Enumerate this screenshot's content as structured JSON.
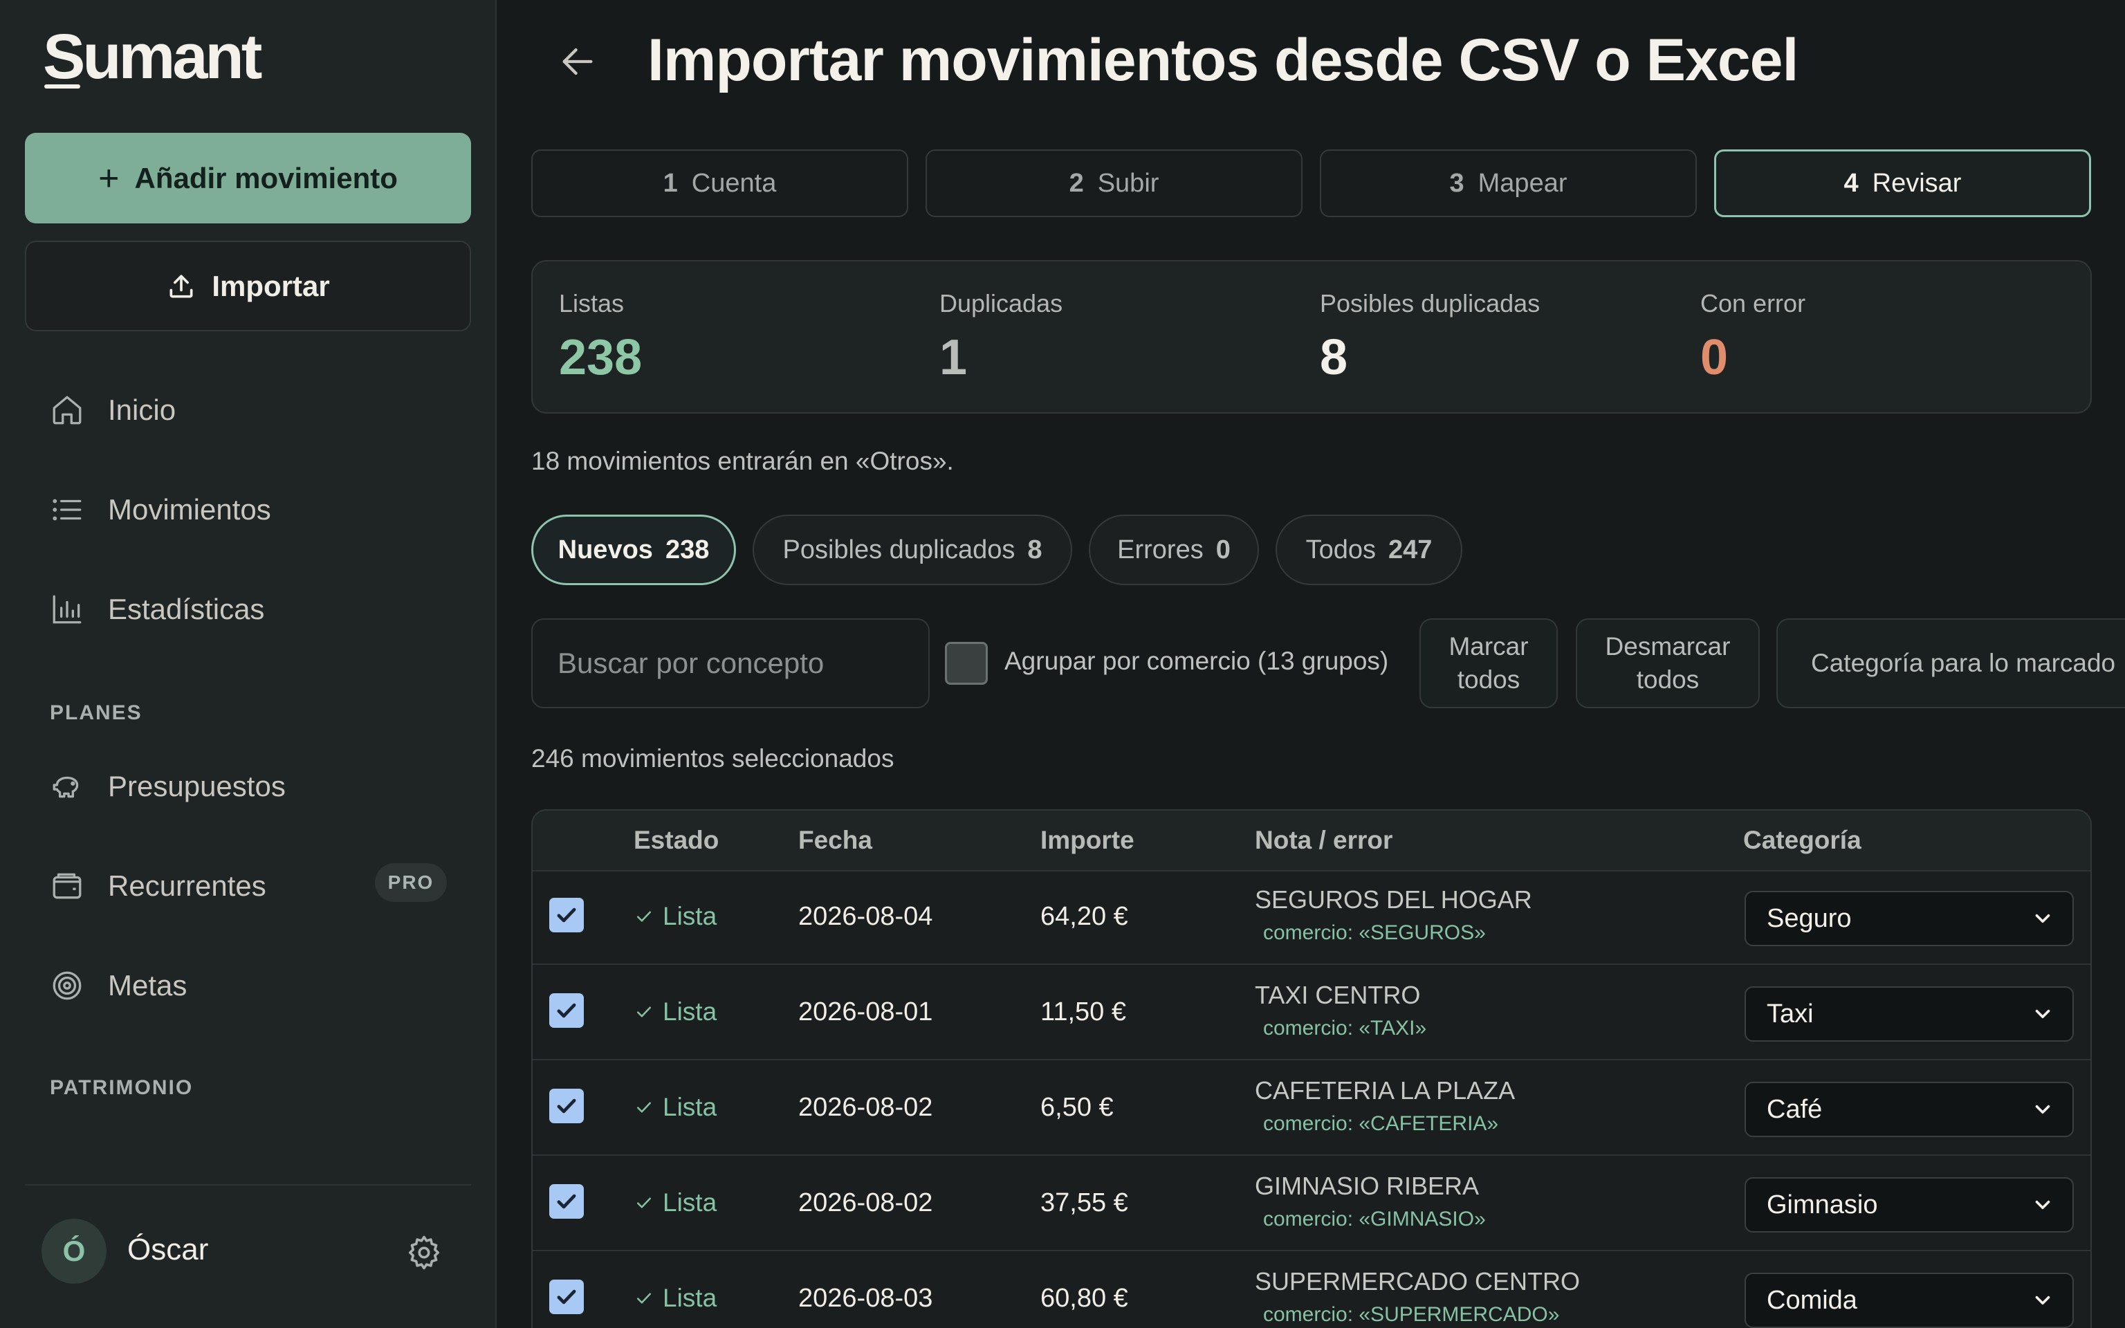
{
  "app": {
    "logo": "Sumant"
  },
  "sidebar": {
    "add_label": "Añadir movimiento",
    "import_label": "Importar",
    "nav": [
      {
        "label": "Inicio",
        "icon": "home-icon"
      },
      {
        "label": "Movimientos",
        "icon": "list-icon"
      },
      {
        "label": "Estadísticas",
        "icon": "chart-icon"
      }
    ],
    "section_planes": "PLANES",
    "planes": [
      {
        "label": "Presupuestos",
        "icon": "piggy-bank-icon"
      },
      {
        "label": "Recurrentes",
        "icon": "wallet-icon",
        "badge": "PRO"
      },
      {
        "label": "Metas",
        "icon": "target-icon"
      }
    ],
    "section_patrimonio": "PATRIMONIO",
    "user": {
      "initial": "Ó",
      "name": "Óscar"
    }
  },
  "header": {
    "title": "Importar movimientos desde CSV o Excel"
  },
  "steps": [
    {
      "num": "1",
      "label": "Cuenta"
    },
    {
      "num": "2",
      "label": "Subir"
    },
    {
      "num": "3",
      "label": "Mapear"
    },
    {
      "num": "4",
      "label": "Revisar",
      "active": true
    }
  ],
  "stats": [
    {
      "label": "Listas",
      "value": "238",
      "color": "#8ec7a5"
    },
    {
      "label": "Duplicadas",
      "value": "1",
      "color": "#b9bdba"
    },
    {
      "label": "Posibles duplicadas",
      "value": "8",
      "color": "#f3f1ea"
    },
    {
      "label": "Con error",
      "value": "0",
      "color": "#e08d6b"
    }
  ],
  "note": "18 movimientos entrarán en «Otros».",
  "filters": [
    {
      "label": "Nuevos",
      "count": "238",
      "active": true
    },
    {
      "label": "Posibles duplicados",
      "count": "8"
    },
    {
      "label": "Errores",
      "count": "0"
    },
    {
      "label": "Todos",
      "count": "247"
    }
  ],
  "toolbar": {
    "search_placeholder": "Buscar por concepto",
    "group_label": "Agrupar por comercio (13 grupos)",
    "mark_all": "Marcar\ntodos",
    "unmark_all": "Desmarcar\ntodos",
    "category_for_marked": "Categoría para lo marcado"
  },
  "selected_count": "246 movimientos seleccionados",
  "table": {
    "headers": {
      "estado": "Estado",
      "fecha": "Fecha",
      "importe": "Importe",
      "nota": "Nota / error",
      "categoria": "Categoría"
    },
    "rows": [
      {
        "estado": "Lista",
        "fecha": "2026-08-04",
        "importe": "64,20 €",
        "concepto": "SEGUROS DEL HOGAR",
        "comercio": "comercio: «SEGUROS»",
        "categoria": "Seguro"
      },
      {
        "estado": "Lista",
        "fecha": "2026-08-01",
        "importe": "11,50 €",
        "concepto": "TAXI CENTRO",
        "comercio": "comercio: «TAXI»",
        "categoria": "Taxi"
      },
      {
        "estado": "Lista",
        "fecha": "2026-08-02",
        "importe": "6,50 €",
        "concepto": "CAFETERIA LA PLAZA",
        "comercio": "comercio: «CAFETERIA»",
        "categoria": "Café"
      },
      {
        "estado": "Lista",
        "fecha": "2026-08-02",
        "importe": "37,55 €",
        "concepto": "GIMNASIO RIBERA",
        "comercio": "comercio: «GIMNASIO»",
        "categoria": "Gimnasio"
      },
      {
        "estado": "Lista",
        "fecha": "2026-08-03",
        "importe": "60,80 €",
        "concepto": "SUPERMERCADO CENTRO",
        "comercio": "comercio: «SUPERMERCADO»",
        "categoria": "Comida"
      }
    ]
  }
}
